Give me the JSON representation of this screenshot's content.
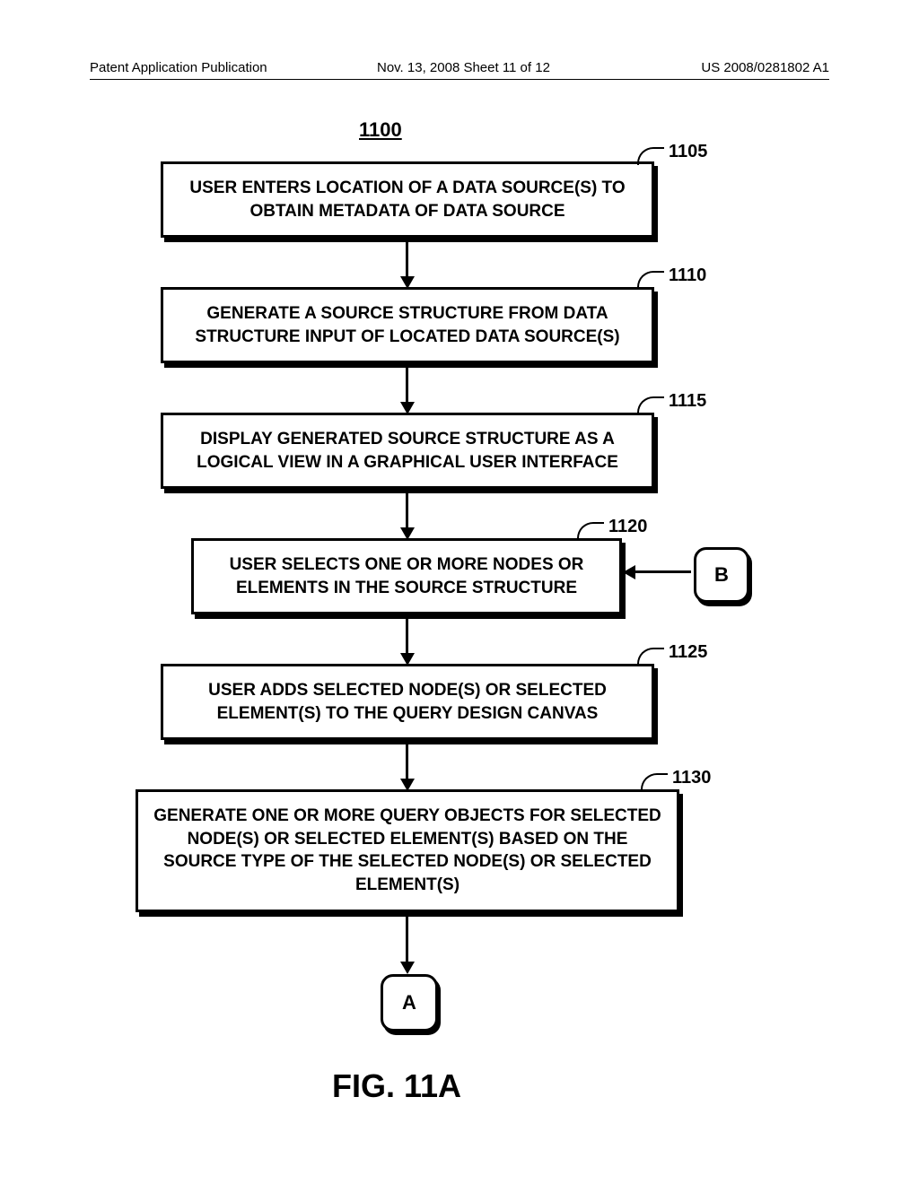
{
  "header": {
    "left": "Patent Application Publication",
    "middle": "Nov. 13, 2008  Sheet 11 of 12",
    "right": "US 2008/0281802 A1"
  },
  "figure_number": "1100",
  "figure_caption": "FIG. 11A",
  "connectors": {
    "a": "A",
    "b": "B"
  },
  "refs": {
    "r1105": "1105",
    "r1110": "1110",
    "r1115": "1115",
    "r1120": "1120",
    "r1125": "1125",
    "r1130": "1130"
  },
  "steps": {
    "s1105": "USER ENTERS LOCATION OF A DATA SOURCE(S) TO OBTAIN METADATA OF DATA SOURCE",
    "s1110": "GENERATE A SOURCE STRUCTURE FROM DATA STRUCTURE INPUT OF  LOCATED DATA SOURCE(S)",
    "s1115": "DISPLAY GENERATED SOURCE STRUCTURE AS A LOGICAL VIEW IN A GRAPHICAL USER INTERFACE",
    "s1120": "USER SELECTS ONE OR MORE NODES OR ELEMENTS IN THE SOURCE STRUCTURE",
    "s1125": "USER ADDS SELECTED NODE(S) OR SELECTED ELEMENT(S) TO THE QUERY DESIGN CANVAS",
    "s1130": "GENERATE ONE OR MORE QUERY OBJECTS FOR SELECTED NODE(S) OR SELECTED ELEMENT(S) BASED ON THE SOURCE TYPE OF THE SELECTED NODE(S) OR SELECTED ELEMENT(S)"
  }
}
